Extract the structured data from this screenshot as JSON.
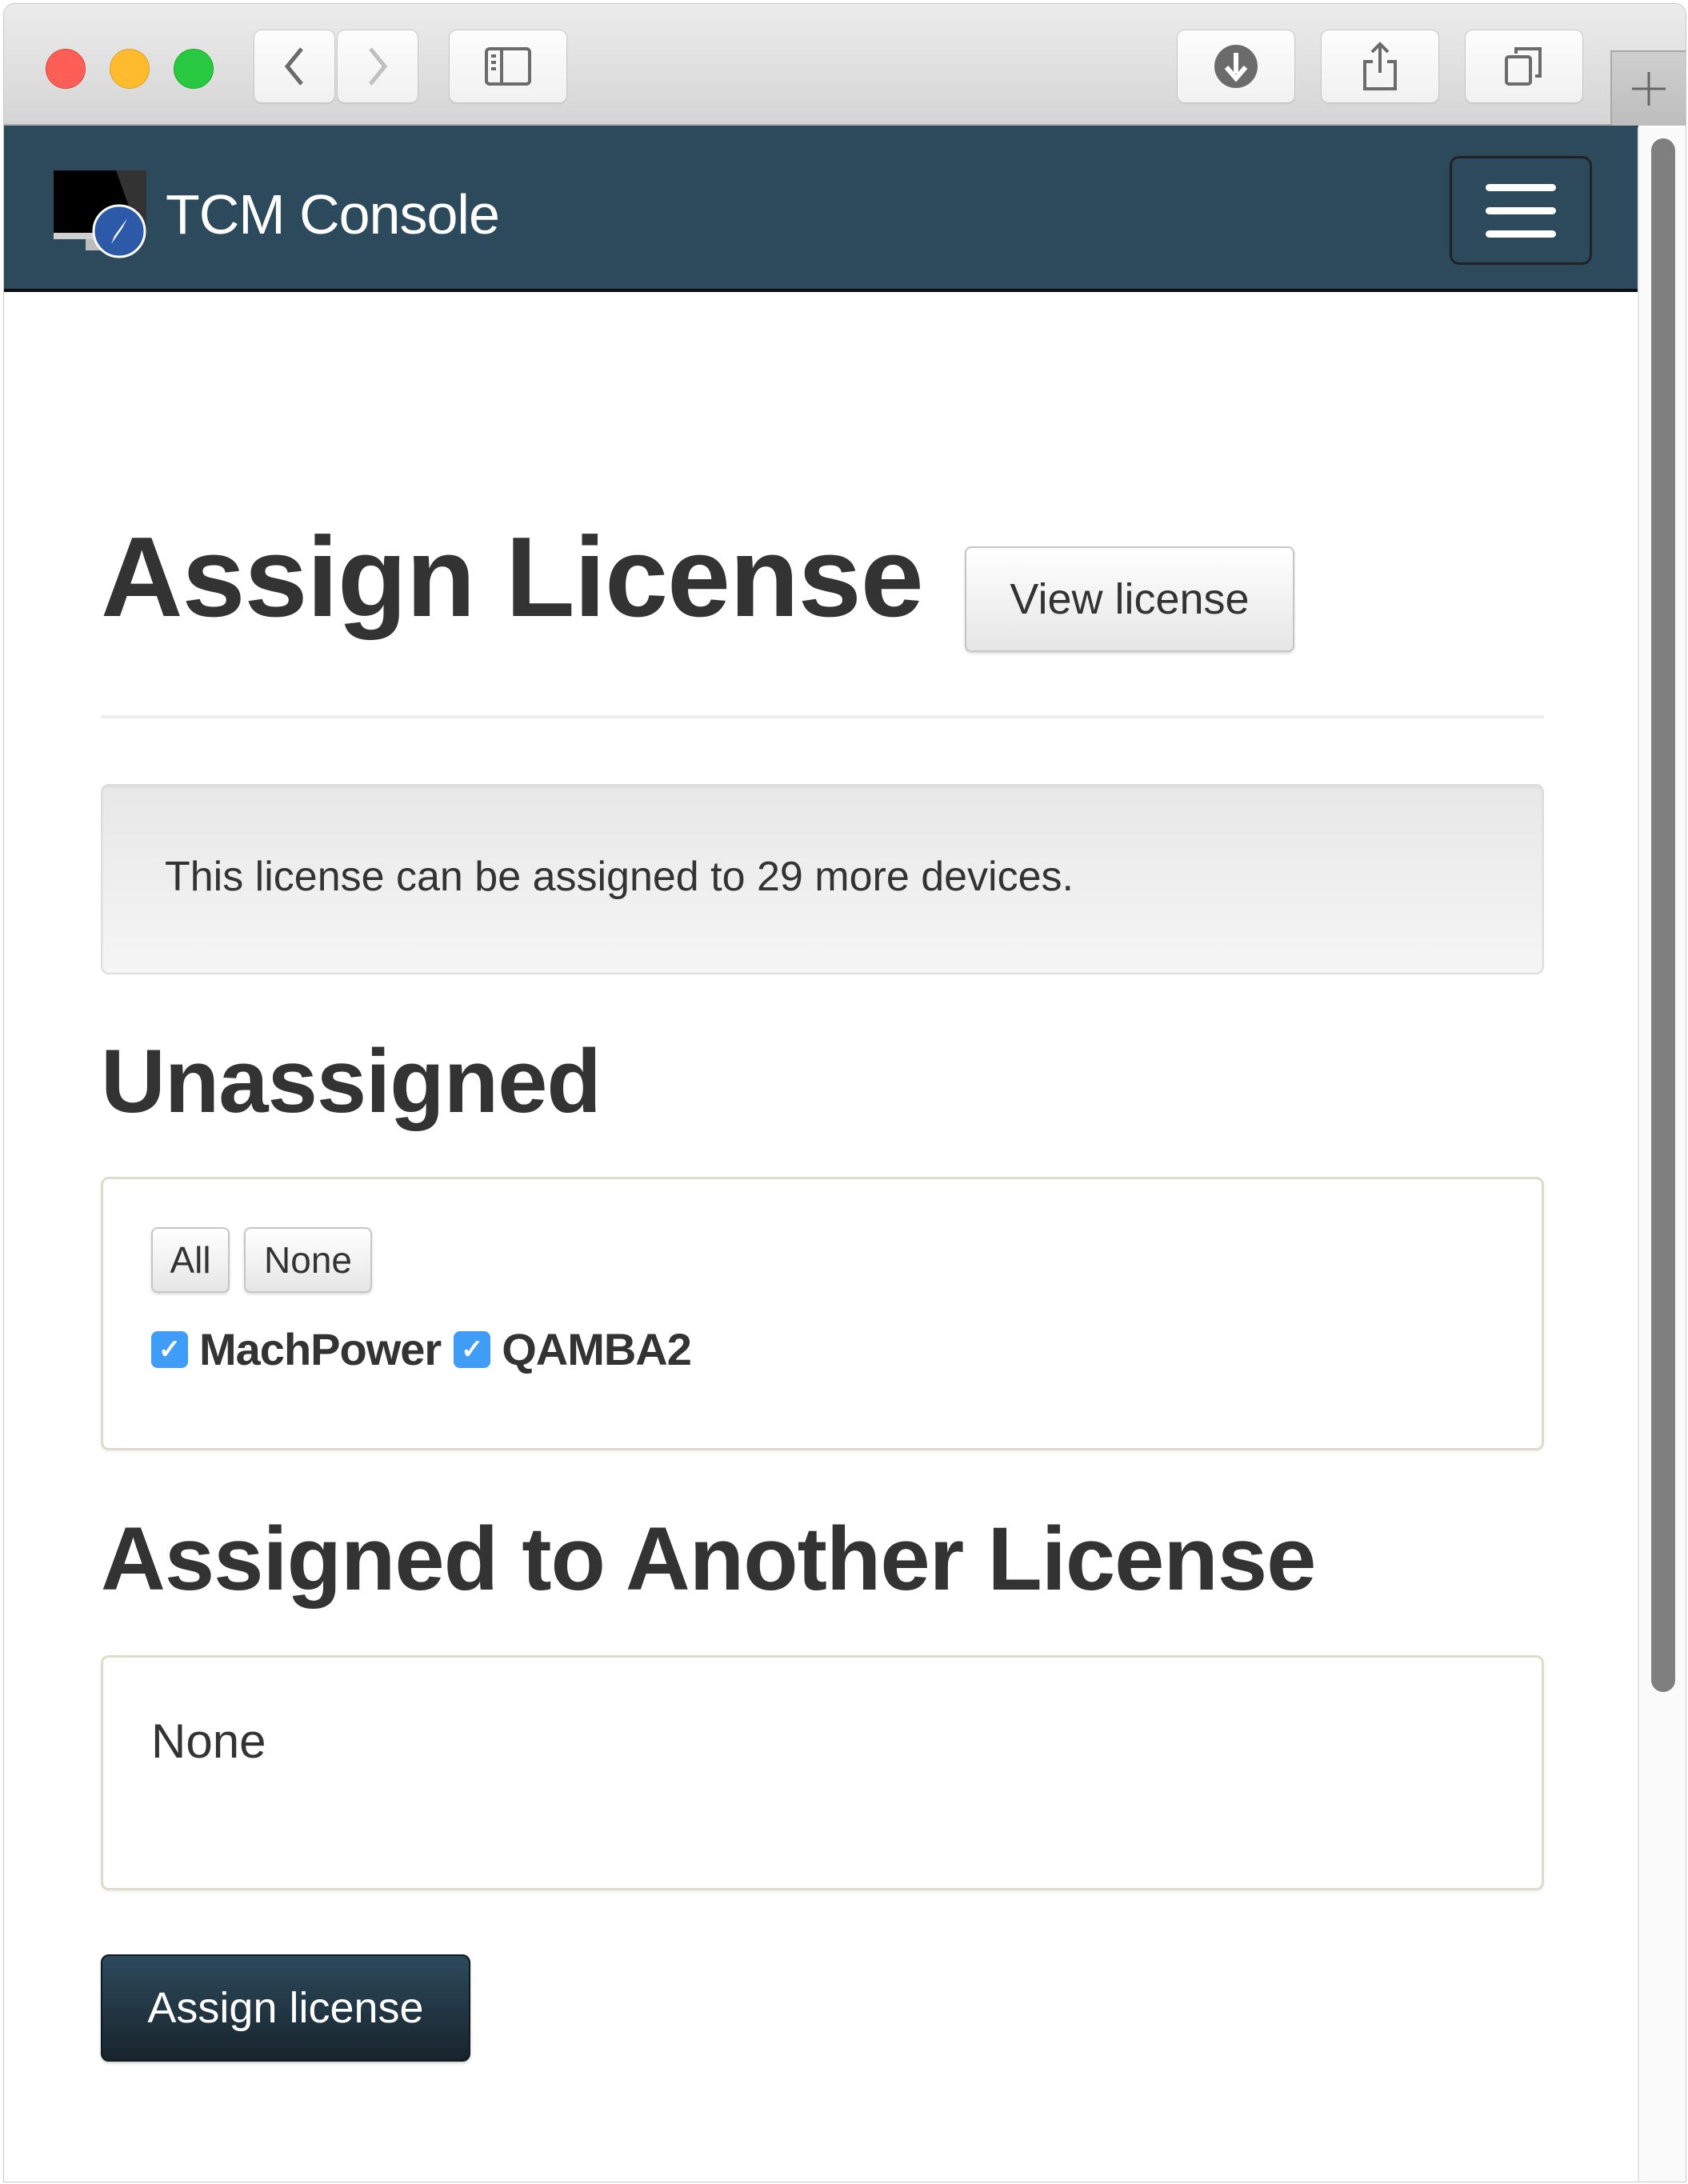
{
  "browser": {
    "traffic_lights": {
      "close": "#fd5f57",
      "minimize": "#fdbb2d",
      "zoom": "#28c941"
    },
    "toolbar_icons": [
      "back-icon",
      "forward-icon",
      "sidebar-icon",
      "download-icon",
      "share-icon",
      "tabs-icon",
      "new-tab-icon"
    ]
  },
  "navbar": {
    "brand": "TCM Console",
    "background": "#2c4a5c",
    "menu_icon": "hamburger-menu-icon"
  },
  "page": {
    "title": "Assign License",
    "view_license_label": "View license",
    "notice": "This license can be assigned to 29 more devices.",
    "unassigned": {
      "heading": "Unassigned",
      "select_all_label": "All",
      "select_none_label": "None",
      "devices": [
        {
          "name": "MachPower",
          "checked": true
        },
        {
          "name": "QAMBA2",
          "checked": true
        }
      ]
    },
    "assigned_elsewhere": {
      "heading": "Assigned to Another License",
      "empty_text": "None"
    },
    "assign_button_label": "Assign license",
    "checkbox_color": "#3f9cf7"
  }
}
